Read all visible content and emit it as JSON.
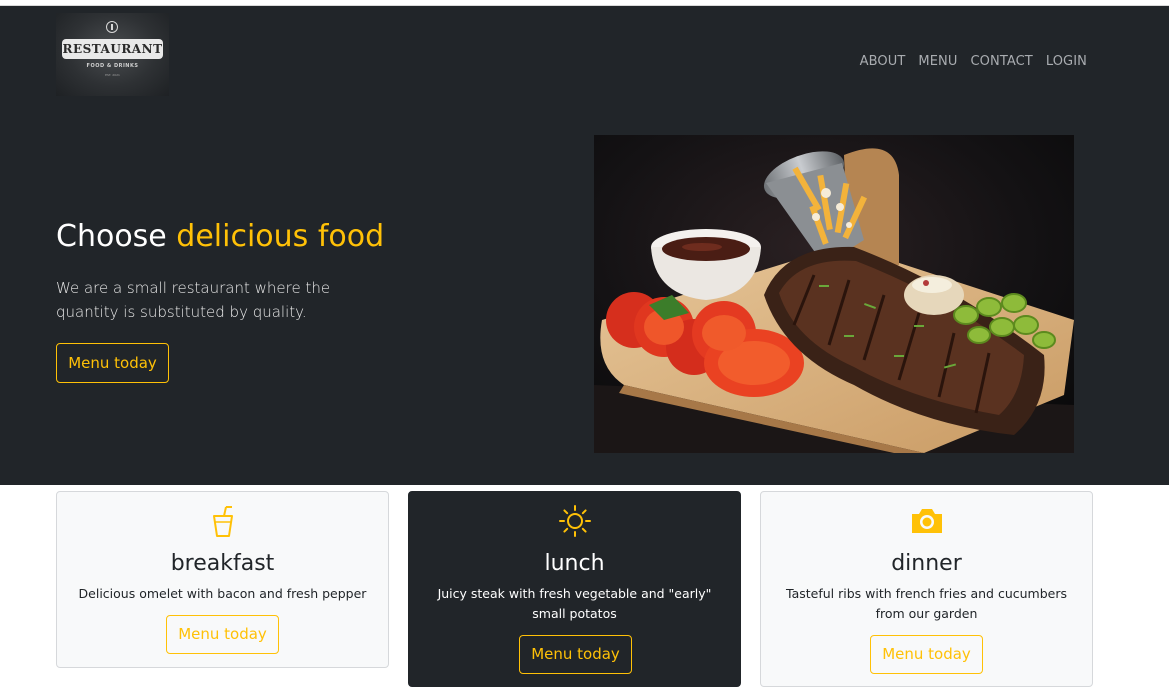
{
  "logo": {
    "brand_text": "RESTAURANT",
    "tagline": "FOOD & DRINKS",
    "est": "EST. 2021"
  },
  "nav": {
    "items": [
      "ABOUT",
      "MENU",
      "CONTACT",
      "LOGIN"
    ]
  },
  "hero": {
    "title_prefix": "Choose ",
    "title_accent": "delicious food",
    "description": "We are a small restaurant where the quantity is substituted by quality.",
    "button_label": "Menu today",
    "image_alt": "Grilled ribs with tomatoes, fries, sauce and pickles on a wooden board"
  },
  "cards": [
    {
      "icon": "cup-straw-icon",
      "title": "breakfast",
      "description": "Delicious omelet with bacon and fresh pepper",
      "button_label": "Menu today",
      "theme": "light"
    },
    {
      "icon": "sun-icon",
      "title": "lunch",
      "description": "Juicy steak with fresh vegetable and \"early\" small potatos",
      "button_label": "Menu today",
      "theme": "dark"
    },
    {
      "icon": "camera-icon",
      "title": "dinner",
      "description": "Tasteful ribs with french fries and cucumbers from our garden",
      "button_label": "Menu today",
      "theme": "light"
    }
  ],
  "colors": {
    "accent": "#ffc107",
    "dark": "#212529",
    "light_card": "#f8f9fa"
  }
}
